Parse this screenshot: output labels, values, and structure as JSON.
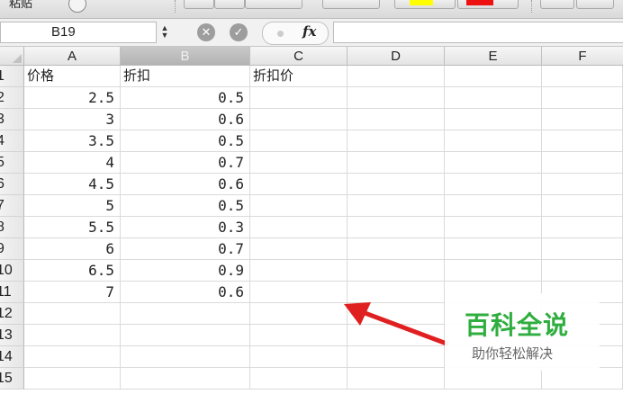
{
  "toolbar": {
    "paste_label": "粘贴",
    "fill_color": "#ffff00",
    "font_color": "#ee1111"
  },
  "formula_bar": {
    "name_box": "B19",
    "stepper_icon": "stepper-updown",
    "cancel_icon": "cancel-x",
    "confirm_icon": "checkmark",
    "fx_label": "fx",
    "formula_value": ""
  },
  "sheet": {
    "columns": [
      "A",
      "B",
      "C",
      "D",
      "E",
      "F"
    ],
    "selected_column": "B",
    "rows": [
      {
        "num": "1",
        "A": "价格",
        "B": "折扣",
        "C": "折扣价"
      },
      {
        "num": "2",
        "A": "2.5",
        "B": "0.5",
        "C": ""
      },
      {
        "num": "3",
        "A": "3",
        "B": "0.6",
        "C": ""
      },
      {
        "num": "4",
        "A": "3.5",
        "B": "0.5",
        "C": ""
      },
      {
        "num": "5",
        "A": "4",
        "B": "0.7",
        "C": ""
      },
      {
        "num": "6",
        "A": "4.5",
        "B": "0.6",
        "C": ""
      },
      {
        "num": "7",
        "A": "5",
        "B": "0.5",
        "C": ""
      },
      {
        "num": "8",
        "A": "5.5",
        "B": "0.3",
        "C": ""
      },
      {
        "num": "9",
        "A": "6",
        "B": "0.7",
        "C": ""
      },
      {
        "num": "10",
        "A": "6.5",
        "B": "0.9",
        "C": ""
      },
      {
        "num": "11",
        "A": "7",
        "B": "0.6",
        "C": ""
      },
      {
        "num": "12",
        "A": "",
        "B": "",
        "C": ""
      },
      {
        "num": "13",
        "A": "",
        "B": "",
        "C": ""
      },
      {
        "num": "14",
        "A": "",
        "B": "",
        "C": ""
      },
      {
        "num": "15",
        "A": "",
        "B": "",
        "C": ""
      }
    ]
  },
  "annotation": {
    "arrow_color": "#e02020"
  },
  "watermark": {
    "title": "百科全说",
    "subtitle": "助你轻松解决",
    "title_color": "#2fae3f"
  }
}
